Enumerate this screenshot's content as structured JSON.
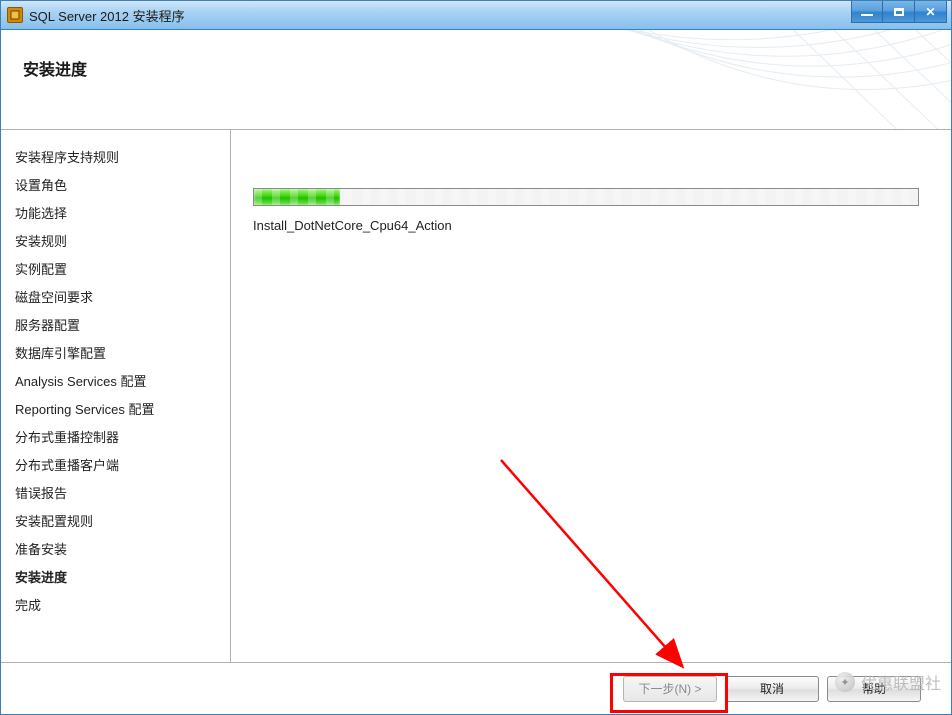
{
  "window": {
    "title": "SQL Server 2012 安装程序"
  },
  "header": {
    "title": "安装进度"
  },
  "sidebar": {
    "items": [
      {
        "label": "安装程序支持规则",
        "current": false
      },
      {
        "label": "设置角色",
        "current": false
      },
      {
        "label": "功能选择",
        "current": false
      },
      {
        "label": "安装规则",
        "current": false
      },
      {
        "label": "实例配置",
        "current": false
      },
      {
        "label": "磁盘空间要求",
        "current": false
      },
      {
        "label": "服务器配置",
        "current": false
      },
      {
        "label": "数据库引擎配置",
        "current": false
      },
      {
        "label": "Analysis Services 配置",
        "current": false
      },
      {
        "label": "Reporting Services 配置",
        "current": false
      },
      {
        "label": "分布式重播控制器",
        "current": false
      },
      {
        "label": "分布式重播客户端",
        "current": false
      },
      {
        "label": "错误报告",
        "current": false
      },
      {
        "label": "安装配置规则",
        "current": false
      },
      {
        "label": "准备安装",
        "current": false
      },
      {
        "label": "安装进度",
        "current": true
      },
      {
        "label": "完成",
        "current": false
      }
    ]
  },
  "progress": {
    "percent": 13,
    "action_label": "Install_DotNetCore_Cpu64_Action"
  },
  "footer": {
    "next_label": "下一步(N) >",
    "cancel_label": "取消",
    "help_label": "帮助"
  },
  "watermark": {
    "text": "优惠联盟社"
  }
}
